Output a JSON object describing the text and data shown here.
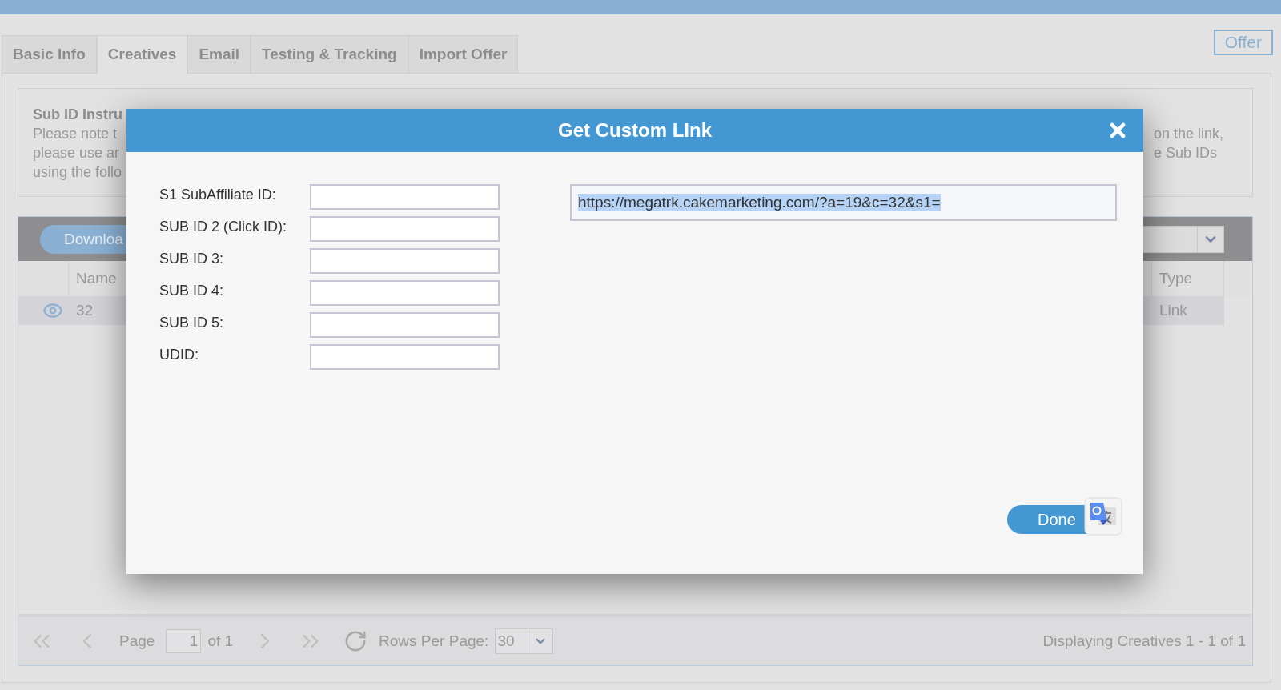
{
  "tabs": [
    {
      "label": "Basic Info",
      "selected": false
    },
    {
      "label": "Creatives",
      "selected": true
    },
    {
      "label": "Email",
      "selected": false
    },
    {
      "label": "Testing & Tracking",
      "selected": false
    },
    {
      "label": "Import Offer",
      "selected": false
    }
  ],
  "offer_button": "Offer",
  "instructions": {
    "title": "Sub ID Instru",
    "lines_left": [
      "Please note t",
      "please use ar",
      "using the follo"
    ],
    "lines_right": [
      "on the link,",
      "e Sub IDs"
    ]
  },
  "grid": {
    "download_button": "Downloa",
    "columns": [
      "Name",
      "Type"
    ],
    "rows": [
      {
        "name": "32",
        "type": "Link",
        "selected": true
      }
    ]
  },
  "pager": {
    "page_label": "Page",
    "page": "1",
    "of": "of 1",
    "rows_label": "Rows Per Page:",
    "rows_per_page": "30",
    "summary": "Displaying Creatives 1 - 1 of 1"
  },
  "dialog": {
    "title": "Get Custom LInk",
    "fields": [
      {
        "label": "S1 SubAffiliate ID:"
      },
      {
        "label": "SUB ID 2 (Click ID):"
      },
      {
        "label": "SUB ID 3:"
      },
      {
        "label": "SUB ID 4:"
      },
      {
        "label": "SUB ID 5:"
      },
      {
        "label": "UDID:"
      }
    ],
    "url": "https://megatrk.cakemarketing.com/?a=19&c=32&s1=",
    "url_selected": true,
    "done_button": "Done"
  }
}
